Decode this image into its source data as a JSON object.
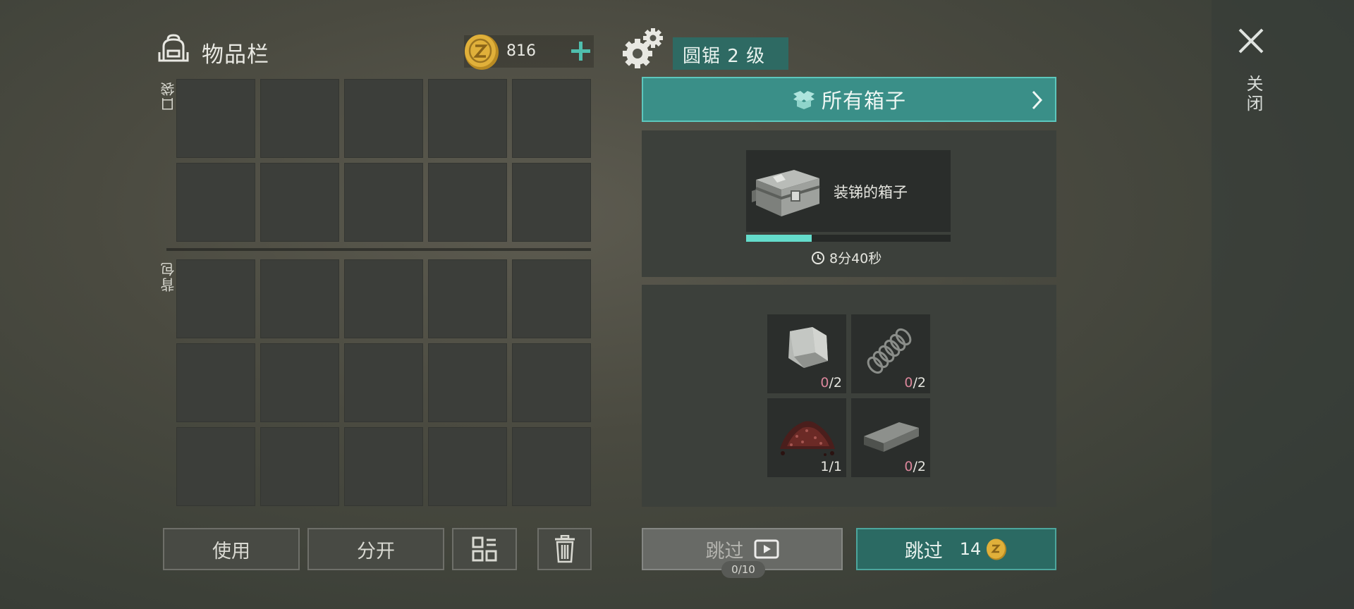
{
  "inventory": {
    "title": "物品栏",
    "coins": "816",
    "pocket_label": "口袋",
    "backpack_label": "背包"
  },
  "actions": {
    "use": "使用",
    "split": "分开"
  },
  "crafting": {
    "station": "圆锯 2 级",
    "all_boxes": "所有箱子",
    "item_name": "装锑的箱子",
    "progress": 0.32,
    "time_left": "8分40秒",
    "materials": [
      {
        "name": "metal-plate",
        "have": "0",
        "need": "/2"
      },
      {
        "name": "spring",
        "have": "0",
        "need": "/2"
      },
      {
        "name": "gunpowder-pile",
        "have": "1",
        "need": "/1"
      },
      {
        "name": "steel-bar",
        "have": "0",
        "need": "/2"
      }
    ],
    "skip_ad_label": "跳过",
    "ad_counter": "0/10",
    "skip_coin_label": "跳过",
    "skip_cost": "14"
  },
  "close_label": "关闭",
  "colors": {
    "accent": "#3a8f88",
    "accent_border": "#5cc7bd",
    "progress": "#64dccb",
    "coin": "#e0b03a",
    "missing": "#d9859a"
  }
}
